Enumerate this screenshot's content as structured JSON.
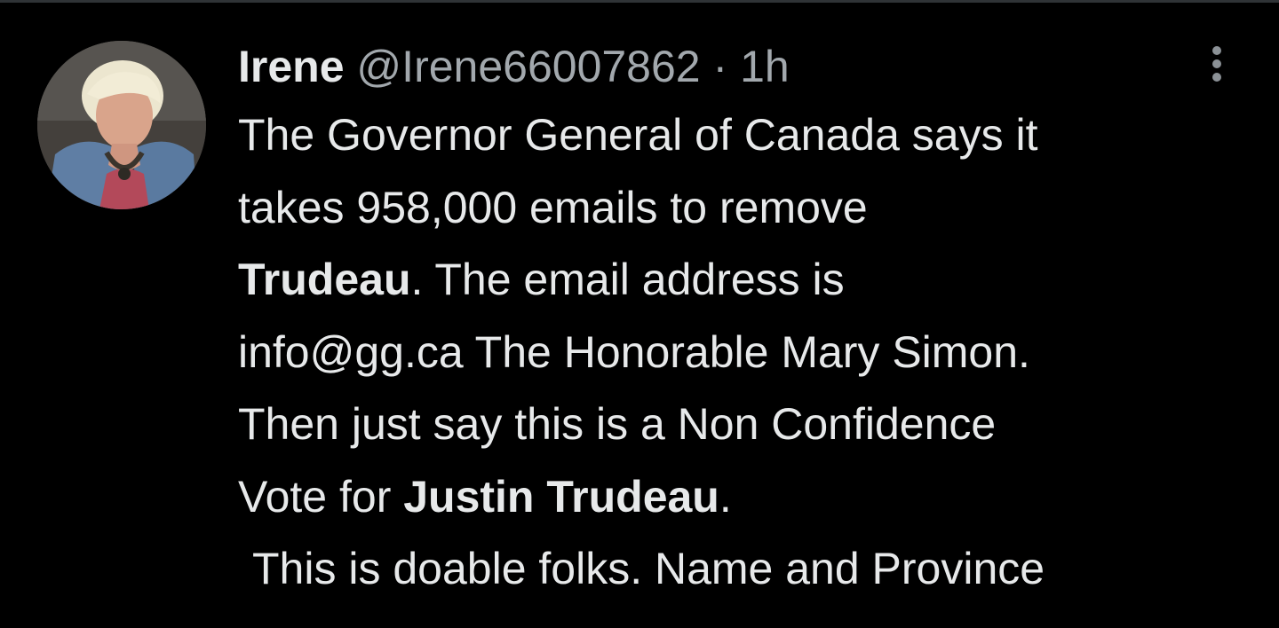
{
  "tweet": {
    "display_name": "Irene",
    "handle": "@Irene66007862",
    "separator": "·",
    "time": "1h",
    "lines": {
      "l1": "The Governor General of Canada says it",
      "l2": "takes 958,000 emails to remove",
      "l3_bold": "Trudeau",
      "l3_rest": ". The email address is",
      "l4": "info@gg.ca The Honorable Mary Simon.",
      "l5": "Then just say this is a Non Confidence",
      "l6_start": "Vote for ",
      "l6_bold": "Justin Trudeau",
      "l6_end": ".",
      "l7": "This is doable folks. Name and Province"
    }
  },
  "icons": {
    "avatar": "profile-photo",
    "more": "more-vertical-icon"
  },
  "colors": {
    "background": "#000000",
    "text_primary": "#e7e9ea",
    "text_secondary": "#a2a8ad"
  }
}
